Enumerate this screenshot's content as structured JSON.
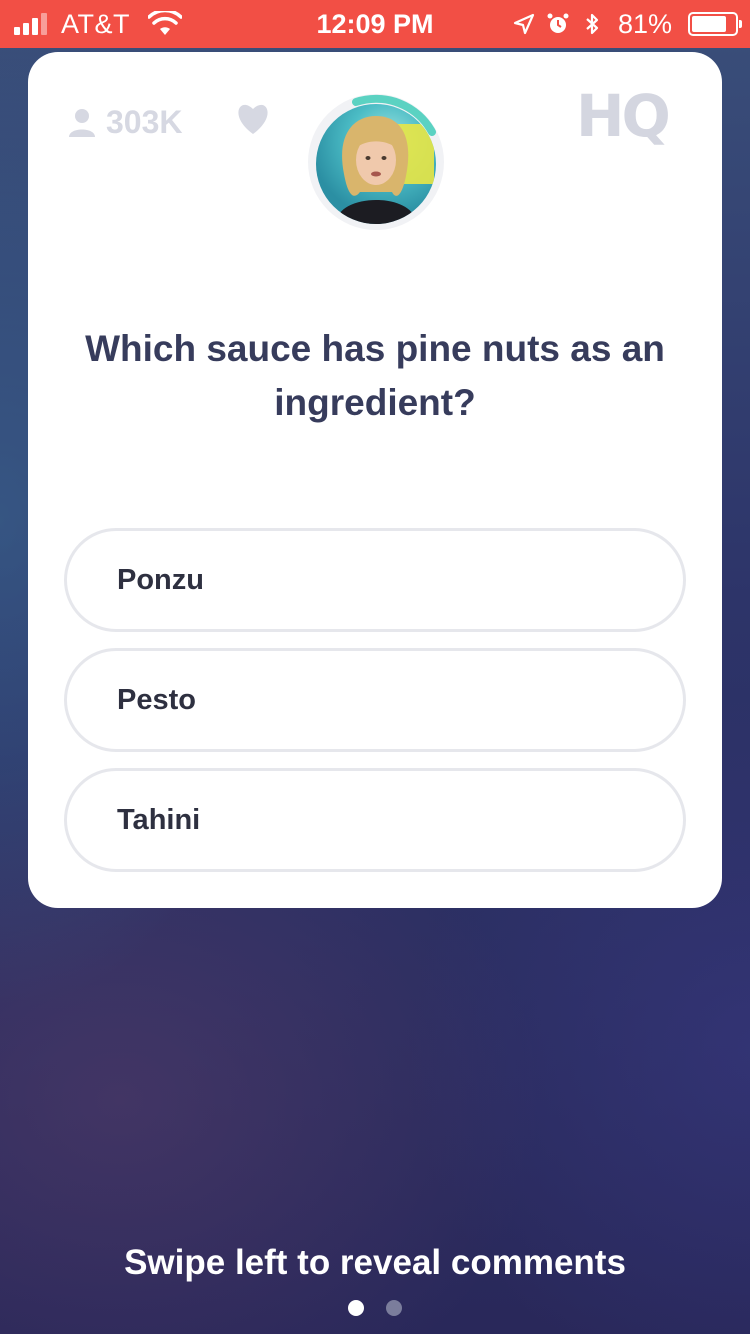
{
  "status_bar": {
    "carrier": "AT&T",
    "time": "12:09 PM",
    "battery_percent": "81%",
    "battery_level": 0.81,
    "icons": [
      "signal-icon",
      "wifi-icon",
      "location-arrow-icon",
      "alarm-icon",
      "bluetooth-icon",
      "battery-icon"
    ]
  },
  "game": {
    "viewer_count": "303K",
    "logo": "HQ",
    "host_avatar_icon": "host-avatar",
    "question": "Which sauce has pine nuts as an ingredient?",
    "answers": [
      {
        "label": "Ponzu"
      },
      {
        "label": "Pesto"
      },
      {
        "label": "Tahini"
      }
    ]
  },
  "footer": {
    "swipe_hint": "Swipe left to reveal comments",
    "page_count": 2,
    "active_page": 1
  },
  "colors": {
    "status_bar": "#f24f45",
    "card": "#ffffff",
    "question_text": "#373c5c",
    "muted_icon": "#d6d8e2"
  }
}
